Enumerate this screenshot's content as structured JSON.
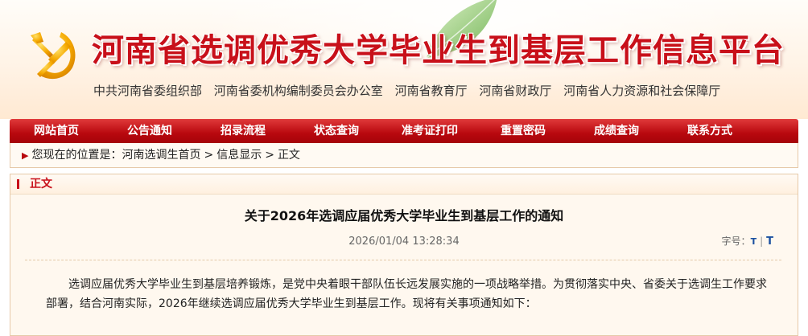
{
  "header": {
    "site_title": "河南省选调优秀大学毕业生到基层工作信息平台",
    "sponsors": [
      "中共河南省委组织部",
      "河南省委机构编制委员会办公室",
      "河南省教育厅",
      "河南省财政厅",
      "河南省人力资源和社会保障厅"
    ]
  },
  "nav": {
    "items": [
      "网站首页",
      "公告通知",
      "招录流程",
      "状态查询",
      "准考证打印",
      "重置密码",
      "成绩查询",
      "联系方式"
    ]
  },
  "breadcrumb": {
    "prefix": "您现在的位置是：",
    "items": [
      "河南选调生首页",
      "信息显示",
      "正文"
    ],
    "separator": ">"
  },
  "panel": {
    "heading": "正文"
  },
  "article": {
    "title": "关于2026年选调应届优秀大学毕业生到基层工作的通知",
    "datetime": "2026/01/04 13:28:34",
    "fontsize_label": "字号：",
    "fontsize_small": "T",
    "fontsize_large": "T",
    "fontsize_divider": "|",
    "body": "选调应届优秀大学毕业生到基层培养锻炼，是党中央着眼干部队伍长远发展实施的一项战略举措。为贯彻落实中央、省委关于选调生工作要求部署，结合河南实际，2026年继续选调应届优秀大学毕业生到基层工作。现将有关事项通知如下："
  },
  "colors": {
    "brand_red": "#c8101a",
    "nav_red": "#b8080e",
    "panel_bg": "#fff8ef"
  },
  "icons": [
    "party-emblem-icon",
    "breadcrumb-arrow-icon",
    "leaf-decoration"
  ]
}
